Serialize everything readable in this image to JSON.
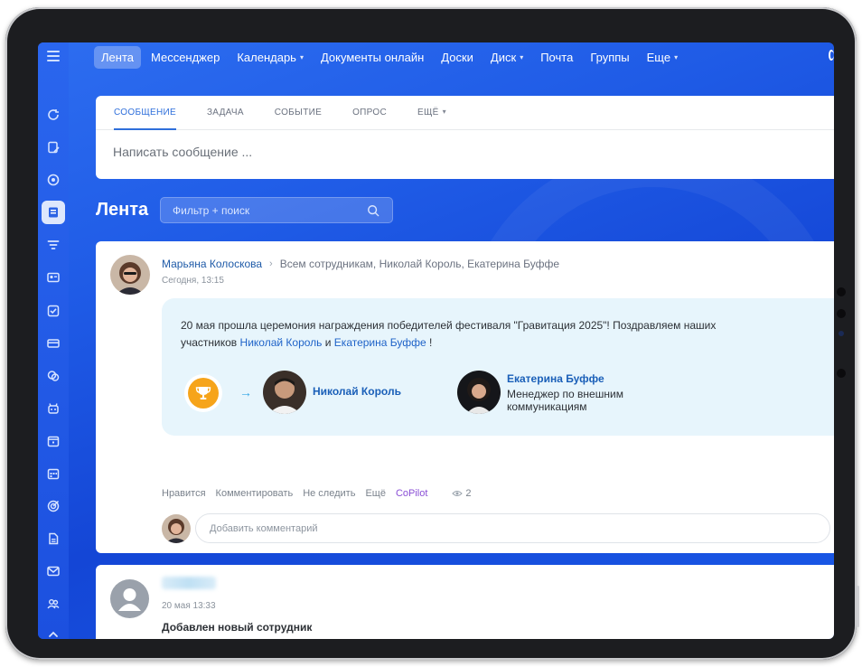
{
  "topnav": {
    "items": [
      {
        "label": "Лента",
        "active": true,
        "caret": false
      },
      {
        "label": "Мессенджер",
        "active": false,
        "caret": false
      },
      {
        "label": "Календарь",
        "active": false,
        "caret": true
      },
      {
        "label": "Документы онлайн",
        "active": false,
        "caret": false
      },
      {
        "label": "Доски",
        "active": false,
        "caret": false
      },
      {
        "label": "Диск",
        "active": false,
        "caret": true
      },
      {
        "label": "Почта",
        "active": false,
        "caret": false
      },
      {
        "label": "Группы",
        "active": false,
        "caret": false
      },
      {
        "label": "Еще",
        "active": false,
        "caret": true
      }
    ]
  },
  "sidebar": {
    "icons": [
      "refresh-icon",
      "edit-document-icon",
      "chat-bubble-icon",
      "feed-icon",
      "filter-icon",
      "id-card-icon",
      "checkbox-icon",
      "card-icon",
      "chats-icon",
      "robot-icon",
      "calendar-icon",
      "calendar-grid-icon",
      "target-icon",
      "document-icon",
      "mail-icon",
      "users-icon",
      "chevron-up-icon"
    ],
    "active_index": 3
  },
  "composer": {
    "tabs": [
      "СООБЩЕНИЕ",
      "ЗАДАЧА",
      "СОБЫТИЕ",
      "ОПРОС",
      "ЕЩЁ"
    ],
    "placeholder": "Написать сообщение ..."
  },
  "feed": {
    "title": "Лента",
    "filter_placeholder": "Фильтр + поиск"
  },
  "post": {
    "author": "Марьяна Колоскова",
    "recipients": "Всем сотрудникам, Николай Король, Екатерина Буффе",
    "time": "Сегодня, 13:15",
    "text_part1": "20 мая прошла церемония награждения победителей фестиваля \"Гравитация 2025\"! Поздравляем наших участников ",
    "mention1": "Николай Король",
    "text_and": " и ",
    "mention2": "Екатерина Буффе",
    "text_end": " !",
    "person1": {
      "name": "Николай Король"
    },
    "person2": {
      "name": "Екатерина Буффе",
      "role": "Менеджер по внешним коммуникациям"
    },
    "actions": {
      "like": "Нравится",
      "comment": "Комментировать",
      "unfollow": "Не следить",
      "more": "Ещё",
      "copilot": "CoPilot",
      "views": "2"
    },
    "comment_placeholder": "Добавить комментарий"
  },
  "post2": {
    "time": "20 мая 13:33",
    "title": "Добавлен новый сотрудник"
  },
  "colors": {
    "accent": "#2f6fdb",
    "link": "#1f63c8",
    "copilot": "#8a4fd6",
    "trophy": "#f6a41a"
  }
}
